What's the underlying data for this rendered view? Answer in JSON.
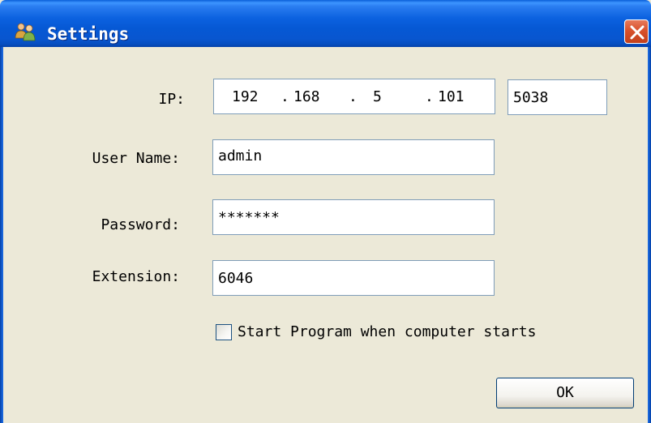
{
  "window": {
    "title": "Settings",
    "icon": "users-icon",
    "close_icon": "close-icon"
  },
  "form": {
    "ip_label": "IP:",
    "ip_octets": [
      "192",
      "168",
      "5",
      "101"
    ],
    "port": "5038",
    "username_label": "User Name:",
    "username": "admin",
    "password_label": "Password:",
    "password": "*******",
    "extension_label": "Extension:",
    "extension": "6046",
    "autostart_label": "Start Program when computer starts",
    "autostart_checked": false
  },
  "buttons": {
    "ok_label": "OK"
  },
  "colors": {
    "titlebar": "#0658d4",
    "window_bg": "#ece9d8",
    "close_button": "#d8512c",
    "field_border": "#7f9db9"
  }
}
